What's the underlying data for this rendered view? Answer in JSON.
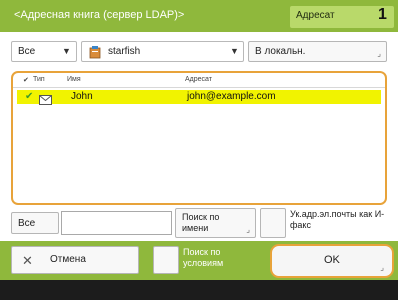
{
  "header": {
    "title": "<Адресная книга (сервер LDAP)>",
    "dest_label": "Адресат",
    "dest_count": "1"
  },
  "filter": {
    "category_value": "Все",
    "server_value": "starfish",
    "local_button": "В локальн.",
    "server_icon": "address-book-icon"
  },
  "list": {
    "headers": {
      "check": "✔",
      "type": "Тип",
      "name": "Имя",
      "address": "Адресат"
    },
    "rows": [
      {
        "checked": "✔",
        "type_icon": "email-icon",
        "name": "John",
        "address": "john@example.com"
      }
    ]
  },
  "search": {
    "all_label": "Все",
    "input_value": "",
    "search_name_button": "Поиск по имени",
    "ifax_button": "Ук.адр.эл.почты как И-факс"
  },
  "footer": {
    "cancel_button": "Отмена",
    "condition_button": "Поиск по условиям",
    "ok_button": "OK"
  },
  "colors": {
    "title_bar": "#8fb83c",
    "selection": "#f1f300",
    "focus_ring": "#e8a33a"
  }
}
